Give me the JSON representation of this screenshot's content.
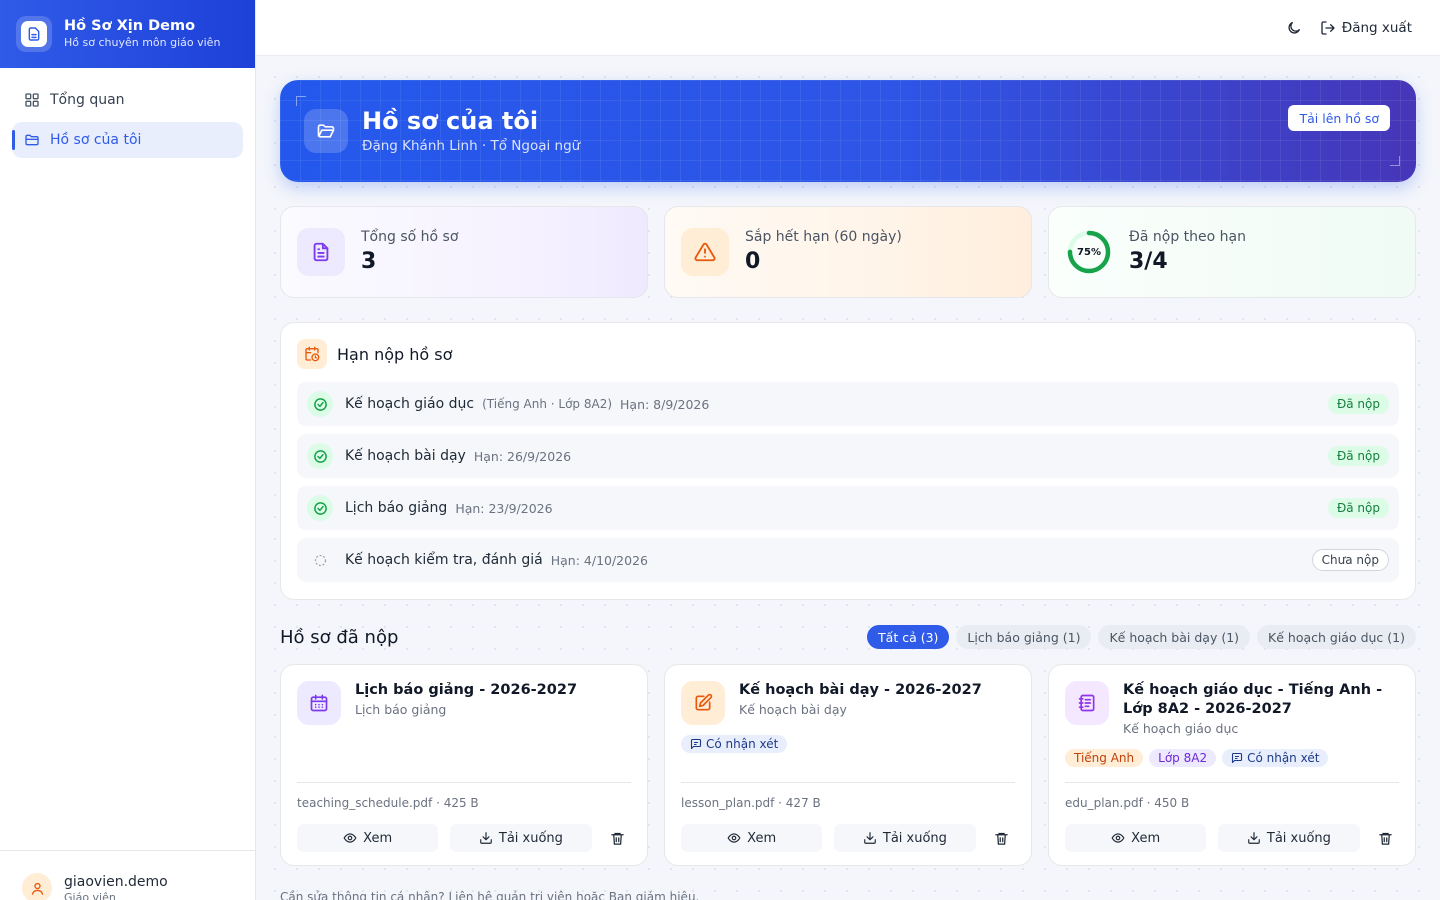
{
  "brand": {
    "title": "Hồ Sơ Xịn Demo",
    "subtitle": "Hồ sơ chuyên môn giáo viên"
  },
  "nav": {
    "items": [
      {
        "label": "Tổng quan",
        "icon": "grid-icon",
        "active": false
      },
      {
        "label": "Hồ sơ của tôi",
        "icon": "folder-icon",
        "active": true
      }
    ]
  },
  "user": {
    "name": "giaovien.demo",
    "role": "Giáo viên"
  },
  "topbar": {
    "logout_label": "Đăng xuất"
  },
  "hero": {
    "title": "Hồ sơ của tôi",
    "subtitle": "Đặng Khánh Linh · Tổ Ngoại ngữ",
    "upload_label": "Tải lên hồ sơ"
  },
  "stats": [
    {
      "label": "Tổng số hồ sơ",
      "value": "3"
    },
    {
      "label": "Sắp hết hạn (60 ngày)",
      "value": "0"
    },
    {
      "label": "Đã nộp theo hạn",
      "value": "3/4",
      "progress_percent": 75,
      "progress_label": "75%"
    }
  ],
  "deadlines": {
    "title": "Hạn nộp hồ sơ",
    "items": [
      {
        "name": "Kế hoạch giáo dục",
        "meta": "(Tiếng Anh · Lớp 8A2)",
        "due": "Hạn: 8/9/2026",
        "status": "Đã nộp",
        "done": true
      },
      {
        "name": "Kế hoạch bài dạy",
        "meta": "",
        "due": "Hạn: 26/9/2026",
        "status": "Đã nộp",
        "done": true
      },
      {
        "name": "Lịch báo giảng",
        "meta": "",
        "due": "Hạn: 23/9/2026",
        "status": "Đã nộp",
        "done": true
      },
      {
        "name": "Kế hoạch kiểm tra, đánh giá",
        "meta": "",
        "due": "Hạn: 4/10/2026",
        "status": "Chưa nộp",
        "done": false
      }
    ]
  },
  "submitted": {
    "title": "Hồ sơ đã nộp",
    "filters": [
      "Tất cả (3)",
      "Lịch báo giảng (1)",
      "Kế hoạch bài dạy (1)",
      "Kế hoạch giáo dục (1)"
    ],
    "files": [
      {
        "name": "Lịch báo giảng - 2026-2027",
        "category": "Lịch báo giảng",
        "file": "teaching_schedule.pdf · 425 B",
        "comment": ""
      },
      {
        "name": "Kế hoạch bài dạy - 2026-2027",
        "category": "Kế hoạch bài dạy",
        "file": "lesson_plan.pdf · 427 B",
        "comment": "Có nhận xét"
      },
      {
        "name": "Kế hoạch giáo dục - Tiếng Anh - Lớp 8A2 - 2026-2027",
        "category": "Kế hoạch giáo dục",
        "file": "edu_plan.pdf · 450 B",
        "subject": "Tiếng Anh",
        "class": "Lớp 8A2",
        "comment": "Có nhận xét"
      }
    ],
    "view_label": "Xem",
    "download_label": "Tải xuống"
  },
  "footnote": "Cần sửa thông tin cá nhân? Liên hệ quản trị viên hoặc Ban giám hiệu.",
  "colors": {
    "primary": "#2f5be8",
    "success": "#16a34a",
    "warning": "#ea580c",
    "purple": "#7c3aed"
  }
}
